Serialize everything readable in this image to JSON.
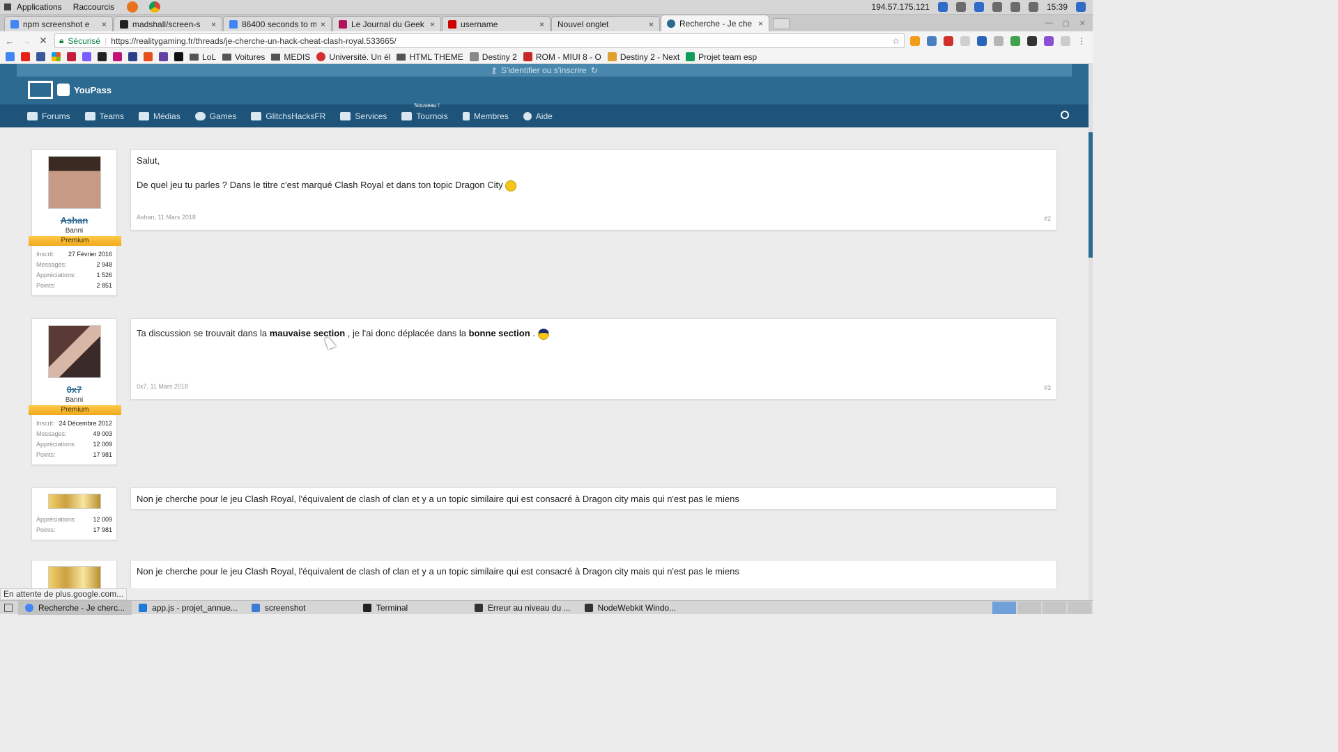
{
  "os": {
    "menu": [
      "Applications",
      "Raccourcis"
    ],
    "ip": "194.57.175.121",
    "time": "15:39"
  },
  "tabs": [
    {
      "title": "npm screenshot e",
      "color": "#4285f4"
    },
    {
      "title": "madshall/screen-s",
      "color": "#222222"
    },
    {
      "title": "86400 seconds to m",
      "color": "#4285f4"
    },
    {
      "title": "Le Journal du Geek",
      "color": "#b0125b"
    },
    {
      "title": "username",
      "color": "#cc0000"
    },
    {
      "title": "Nouvel onglet",
      "color": "#dddddd"
    },
    {
      "title": "Recherche - Je che",
      "color": "#2c6a92",
      "active": true
    }
  ],
  "address": {
    "secure_label": "Sécurisé",
    "url": "https://realitygaming.fr/threads/je-cherche-un-hack-cheat-clash-royal.533665/"
  },
  "bookmarks": [
    "LoL",
    "Voitures",
    "MEDIS",
    "Université. Un él",
    "HTML THEME",
    "Destiny 2",
    "ROM - MIUI 8 - O",
    "Destiny 2 - Next",
    "Projet team esp"
  ],
  "site": {
    "login_label": "S'identifier ou s'inscrire",
    "logo_label": "YouPass",
    "nav": [
      {
        "label": "Forums",
        "icon": "chat-icon"
      },
      {
        "label": "Teams",
        "icon": "group-icon"
      },
      {
        "label": "Médias",
        "icon": "media-icon"
      },
      {
        "label": "Games",
        "icon": "gamepad-icon"
      },
      {
        "label": "GlitchsHacksFR",
        "icon": "youtube-icon"
      },
      {
        "label": "Services",
        "icon": "cart-icon"
      },
      {
        "label": "Tournois",
        "icon": "trophy-icon",
        "badge": "Nouveau !"
      },
      {
        "label": "Membres",
        "icon": "user-icon"
      },
      {
        "label": "Aide",
        "icon": "info-icon"
      }
    ]
  },
  "posts": [
    {
      "user": {
        "name": "Ashan",
        "title": "Banni",
        "rank": "Premium",
        "stats": [
          {
            "k": "Inscrit:",
            "v": "27 Février 2016"
          },
          {
            "k": "Messages:",
            "v": "2 948"
          },
          {
            "k": "Appréciations:",
            "v": "1 526"
          },
          {
            "k": "Points:",
            "v": "2 851"
          }
        ]
      },
      "lines": [
        "Salut,",
        "De quel jeu tu parles ? Dans le titre c'est marqué Clash Royal et dans ton topic Dragon City"
      ],
      "meta": "Ashan, 11 Mars 2018",
      "number": "#2"
    },
    {
      "user": {
        "name": "0x7",
        "title": "Banni",
        "rank": "Premium",
        "stats": [
          {
            "k": "Inscrit:",
            "v": "24 Décembre 2012"
          },
          {
            "k": "Messages:",
            "v": "49 003"
          },
          {
            "k": "Appréciations:",
            "v": "12 009"
          },
          {
            "k": "Points:",
            "v": "17 981"
          }
        ]
      },
      "text": {
        "a": "Ta discussion se trouvait dans la ",
        "b": "mauvaise section",
        "c": " , je l'ai donc déplacée dans la ",
        "d": "bonne section",
        "e": " ."
      },
      "meta": "0x7, 11 Mars 2018",
      "number": "#3"
    },
    {
      "user": {
        "stats": [
          {
            "k": "Appréciations:",
            "v": "12 009"
          },
          {
            "k": "Points:",
            "v": "17 981"
          }
        ]
      },
      "line": "Non je cherche pour le jeu Clash Royal, l'équivalent de clash of clan et y a un topic similaire qui est consacré à Dragon city mais qui n'est pas le miens"
    },
    {
      "line": "Non je cherche pour le jeu Clash Royal, l'équivalent de clash of clan et y a un topic similaire qui est consacré à Dragon city mais qui n'est pas le miens"
    }
  ],
  "status": "En attente de plus.google.com...",
  "taskbar": [
    {
      "label": "Recherche - Je cherc...",
      "active": true
    },
    {
      "label": "app.js - projet_annue..."
    },
    {
      "label": "screenshot"
    },
    {
      "label": "Terminal"
    },
    {
      "label": "Erreur au niveau du ..."
    },
    {
      "label": "NodeWebkit Windo..."
    }
  ]
}
